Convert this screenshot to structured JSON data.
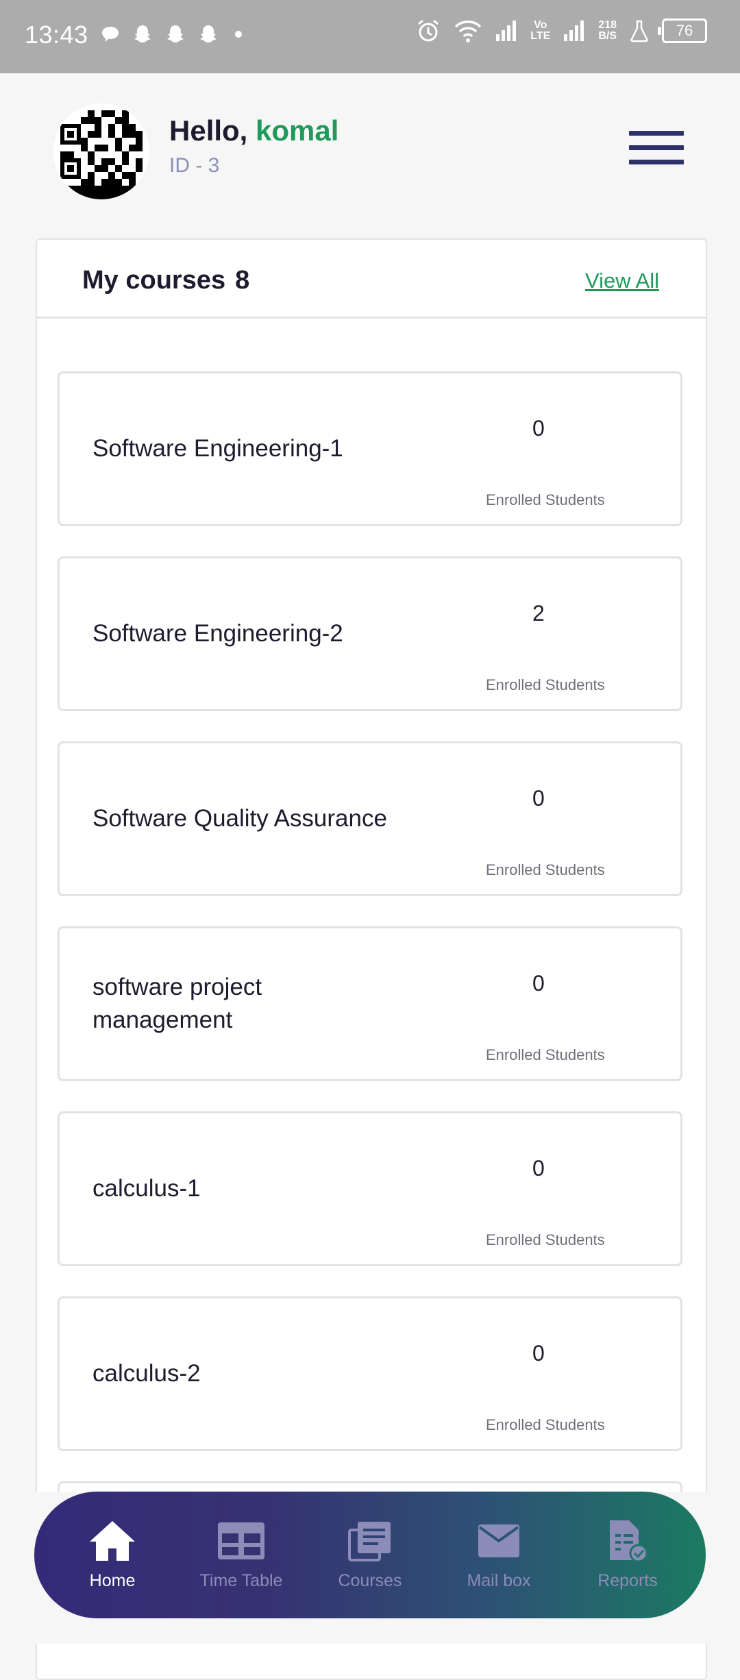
{
  "status_bar": {
    "time": "13:43",
    "network_speed": "218",
    "network_unit": "B/S",
    "volte_top": "Vo",
    "volte_bottom": "LTE",
    "battery": "76"
  },
  "header": {
    "greeting": "Hello, ",
    "user_name": "komal",
    "user_id": "ID - 3"
  },
  "courses": {
    "title": "My courses",
    "count": "8",
    "view_all": "View All",
    "items": [
      {
        "name": "Software Engineering-1",
        "enrolled": "0",
        "label": "Enrolled Students"
      },
      {
        "name": "Software Engineering-2",
        "enrolled": "2",
        "label": "Enrolled Students"
      },
      {
        "name": "Software Quality Assurance",
        "enrolled": "0",
        "label": "Enrolled Students"
      },
      {
        "name": "software project management",
        "enrolled": "0",
        "label": "Enrolled Students"
      },
      {
        "name": "calculus-1",
        "enrolled": "0",
        "label": "Enrolled Students"
      },
      {
        "name": "calculus-2",
        "enrolled": "0",
        "label": "Enrolled Students"
      }
    ]
  },
  "bottom_nav": [
    {
      "label": "Home",
      "icon": "home-icon",
      "active": true
    },
    {
      "label": "Time Table",
      "icon": "timetable-icon",
      "active": false
    },
    {
      "label": "Courses",
      "icon": "courses-icon",
      "active": false
    },
    {
      "label": "Mail box",
      "icon": "mail-icon",
      "active": false
    },
    {
      "label": "Reports",
      "icon": "reports-icon",
      "active": false
    }
  ],
  "colors": {
    "accent_green": "#1f9a59",
    "menu_navy": "#2e3068",
    "nav_gradient_start": "#352a78",
    "nav_gradient_end": "#1b7a62"
  }
}
